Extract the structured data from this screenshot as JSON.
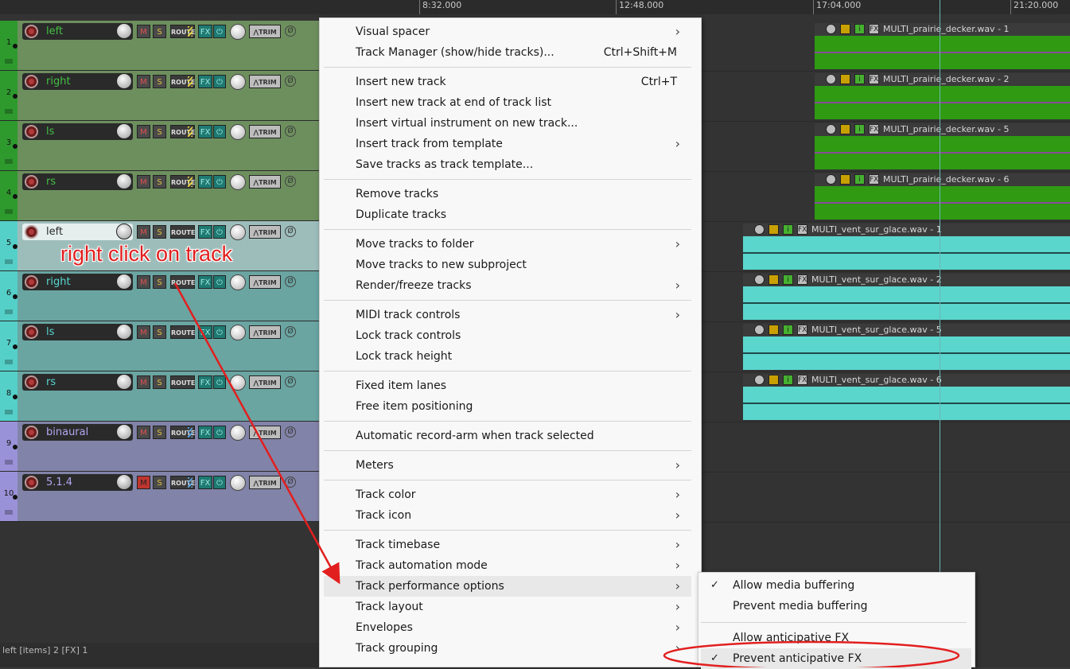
{
  "ruler": {
    "ticks": [
      "8:32.000",
      "12:48.000",
      "17:04.000",
      "21:20.000"
    ]
  },
  "tracks": [
    {
      "num": "1",
      "name": "left",
      "color": "#6d8f5e",
      "strip": "#2e9a2e",
      "name_color": "#43c043",
      "route_stripe": "#e0d040"
    },
    {
      "num": "2",
      "name": "right",
      "color": "#6d8f5e",
      "strip": "#2e9a2e",
      "name_color": "#43c043",
      "route_stripe": "#e0d040"
    },
    {
      "num": "3",
      "name": "ls",
      "color": "#6d8f5e",
      "strip": "#2e9a2e",
      "name_color": "#43c043",
      "route_stripe": "#e0d040"
    },
    {
      "num": "4",
      "name": "rs",
      "color": "#6d8f5e",
      "strip": "#2e9a2e",
      "name_color": "#43c043",
      "route_stripe": "#e0d040"
    },
    {
      "num": "5",
      "name": "left",
      "color": "#9dbdbb",
      "strip": "#55d0c8",
      "name_color": "#2a2a2a",
      "route_stripe": ""
    },
    {
      "num": "6",
      "name": "right",
      "color": "#6aa5a2",
      "strip": "#55d0c8",
      "name_color": "#55d8d0",
      "route_stripe": ""
    },
    {
      "num": "7",
      "name": "ls",
      "color": "#6aa5a2",
      "strip": "#55d0c8",
      "name_color": "#55d8d0",
      "route_stripe": ""
    },
    {
      "num": "8",
      "name": "rs",
      "color": "#6aa5a2",
      "strip": "#55d0c8",
      "name_color": "#55d8d0",
      "route_stripe": ""
    },
    {
      "num": "9",
      "name": "binaural",
      "color": "#8283a8",
      "strip": "#9a92d8",
      "name_color": "#b0a8f0",
      "route_stripe": "#5aa0d8"
    },
    {
      "num": "10",
      "name": "5.1.4",
      "color": "#8283a8",
      "strip": "#9a92d8",
      "name_color": "#b0a8f0",
      "route_stripe": "#5aa0d8"
    }
  ],
  "track_controls": {
    "mute": "M",
    "solo": "S",
    "route": "ROUTE",
    "fx": "FX",
    "power": "⏻",
    "trim": "TRIM",
    "phase": "Ø"
  },
  "items": [
    {
      "track": 1,
      "name": "MULTI_prairie_decker.wav - 1",
      "color": "#2f9a12"
    },
    {
      "track": 2,
      "name": "MULTI_prairie_decker.wav - 2",
      "color": "#2f9a12"
    },
    {
      "track": 3,
      "name": "MULTI_prairie_decker.wav - 5",
      "color": "#2f9a12"
    },
    {
      "track": 4,
      "name": "MULTI_prairie_decker.wav - 6",
      "color": "#2f9a12"
    },
    {
      "track": 5,
      "name": "MULTI_vent_sur_glace.wav - 1",
      "color": "#5ad6cd"
    },
    {
      "track": 6,
      "name": "MULTI_vent_sur_glace.wav - 2",
      "color": "#5ad6cd"
    },
    {
      "track": 7,
      "name": "MULTI_vent_sur_glace.wav - 5",
      "color": "#5ad6cd"
    },
    {
      "track": 8,
      "name": "MULTI_vent_sur_glace.wav - 6",
      "color": "#5ad6cd"
    }
  ],
  "item_icons": {
    "fx": "FX",
    "info": "i"
  },
  "status": {
    "text": "left [items] 2 [FX] 1"
  },
  "annotation": {
    "text": "right click on track"
  },
  "context_menu": {
    "items": [
      {
        "label": "Visual spacer",
        "shortcut": "",
        "submenu": true
      },
      {
        "label": "Track Manager (show/hide tracks)...",
        "shortcut": "Ctrl+Shift+M",
        "submenu": false
      },
      {
        "sep": true
      },
      {
        "label": "Insert new track",
        "shortcut": "Ctrl+T",
        "submenu": false
      },
      {
        "label": "Insert new track at end of track list",
        "shortcut": "",
        "submenu": false
      },
      {
        "label": "Insert virtual instrument on new track...",
        "shortcut": "",
        "submenu": false
      },
      {
        "label": "Insert track from template",
        "shortcut": "",
        "submenu": true
      },
      {
        "label": "Save tracks as track template...",
        "shortcut": "",
        "submenu": false
      },
      {
        "sep": true
      },
      {
        "label": "Remove tracks",
        "shortcut": "",
        "submenu": false
      },
      {
        "label": "Duplicate tracks",
        "shortcut": "",
        "submenu": false
      },
      {
        "sep": true
      },
      {
        "label": "Move tracks to folder",
        "shortcut": "",
        "submenu": true
      },
      {
        "label": "Move tracks to new subproject",
        "shortcut": "",
        "submenu": false
      },
      {
        "label": "Render/freeze tracks",
        "shortcut": "",
        "submenu": true
      },
      {
        "sep": true
      },
      {
        "label": "MIDI track controls",
        "shortcut": "",
        "submenu": true
      },
      {
        "label": "Lock track controls",
        "shortcut": "",
        "submenu": false
      },
      {
        "label": "Lock track height",
        "shortcut": "",
        "submenu": false
      },
      {
        "sep": true
      },
      {
        "label": "Fixed item lanes",
        "shortcut": "",
        "submenu": false
      },
      {
        "label": "Free item positioning",
        "shortcut": "",
        "submenu": false
      },
      {
        "sep": true
      },
      {
        "label": "Automatic record-arm when track selected",
        "shortcut": "",
        "submenu": false
      },
      {
        "sep": true
      },
      {
        "label": "Meters",
        "shortcut": "",
        "submenu": true
      },
      {
        "sep": true
      },
      {
        "label": "Track color",
        "shortcut": "",
        "submenu": true
      },
      {
        "label": "Track icon",
        "shortcut": "",
        "submenu": true
      },
      {
        "sep": true
      },
      {
        "label": "Track timebase",
        "shortcut": "",
        "submenu": true
      },
      {
        "label": "Track automation mode",
        "shortcut": "",
        "submenu": true
      },
      {
        "label": "Track performance options",
        "shortcut": "",
        "submenu": true,
        "highlight": true
      },
      {
        "label": "Track layout",
        "shortcut": "",
        "submenu": true
      },
      {
        "label": "Envelopes",
        "shortcut": "",
        "submenu": true
      },
      {
        "label": "Track grouping",
        "shortcut": "",
        "submenu": true
      }
    ]
  },
  "submenu": {
    "items": [
      {
        "label": "Allow media buffering",
        "checked": true
      },
      {
        "label": "Prevent media buffering",
        "checked": false
      },
      {
        "sep": true
      },
      {
        "label": "Allow anticipative FX",
        "checked": false
      },
      {
        "label": "Prevent anticipative FX",
        "checked": true,
        "highlight": true
      }
    ]
  },
  "glyphs": {
    "submenu_arrow": "›",
    "check": "✓"
  }
}
